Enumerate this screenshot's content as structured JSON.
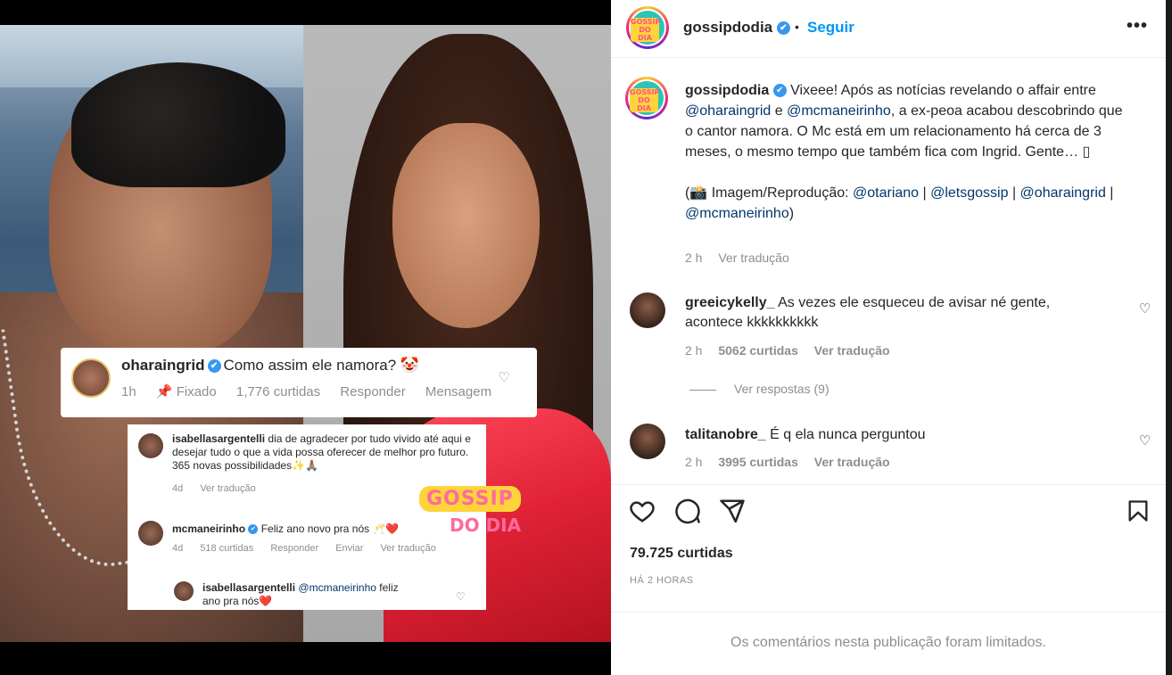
{
  "post_image": {
    "card1": {
      "username": "oharaingrid",
      "text": "Como assim ele namora? 🤡",
      "meta": [
        "1h",
        "📌 Fixado",
        "1,776 curtidas",
        "Responder",
        "Mensagem"
      ]
    },
    "card2": {
      "c1_user": "isabellasargentelli",
      "c1_text": " dia de agradecer por tudo vivido até aqui e desejar tudo o que a vida possa oferecer de melhor pro futuro. 365 novas possibilidades✨🙏🏽",
      "c1_meta": [
        "4d",
        "Ver tradução"
      ],
      "c2_user": "mcmaneirinho",
      "c2_text": " Feliz ano novo pra nós 🥂❤️",
      "c2_meta": [
        "4d",
        "518 curtidas",
        "Responder",
        "Enviar",
        "Ver tradução"
      ],
      "c3_user": "isabellasargentelli",
      "c3_mention": " @mcmaneirinho",
      "c3_text": " feliz ano pra nós❤️"
    },
    "watermark_line1": "GOSSIP",
    "watermark_line2": "DO DIA"
  },
  "header": {
    "avatar_text": "GOSSIP DO DIA",
    "username": "gossipdodia",
    "verified": "✔",
    "dot": "•",
    "follow_label": "Seguir",
    "more_label": "•••"
  },
  "caption": {
    "username": "gossipdodia",
    "verified": "✔",
    "text1": " Vixeee! Após as notícias revelando o affair entre ",
    "mention1": "@oharaingrid",
    "text2": " e ",
    "mention2": "@mcmaneirinho",
    "text3": ", a ex-peoa acabou descobrindo que o cantor namora. O Mc está em um relacionamento há cerca de 3 meses, o mesmo tempo que também fica com Ingrid. Gente… ▯",
    "credits_prefix": "(📸 Imagem/Reprodução: ",
    "credit1": "@otariano",
    "sep1": " | ",
    "credit2": "@letsgossip",
    "sep2": " | ",
    "credit3": "@oharaingrid",
    "sep3": " | ",
    "credit4": "@mcmaneirinho",
    "credits_suffix": ")",
    "time": "2 h",
    "translate": "Ver tradução"
  },
  "comments": [
    {
      "username": "greeicykelly_",
      "text": " As vezes ele esqueceu de avisar né gente, acontece kkkkkkkkkk",
      "time": "2 h",
      "likes": "5062 curtidas",
      "translate": "Ver tradução"
    },
    {
      "username": "talitanobre_",
      "text": " É q ela nunca perguntou",
      "time": "2 h",
      "likes": "3995 curtidas",
      "translate": "Ver tradução"
    }
  ],
  "replies_label": "Ver respostas (9)",
  "likes_count": "79.725 curtidas",
  "posted_time": "HÁ 2 HORAS",
  "comments_limited": "Os comentários nesta publicação foram limitados."
}
